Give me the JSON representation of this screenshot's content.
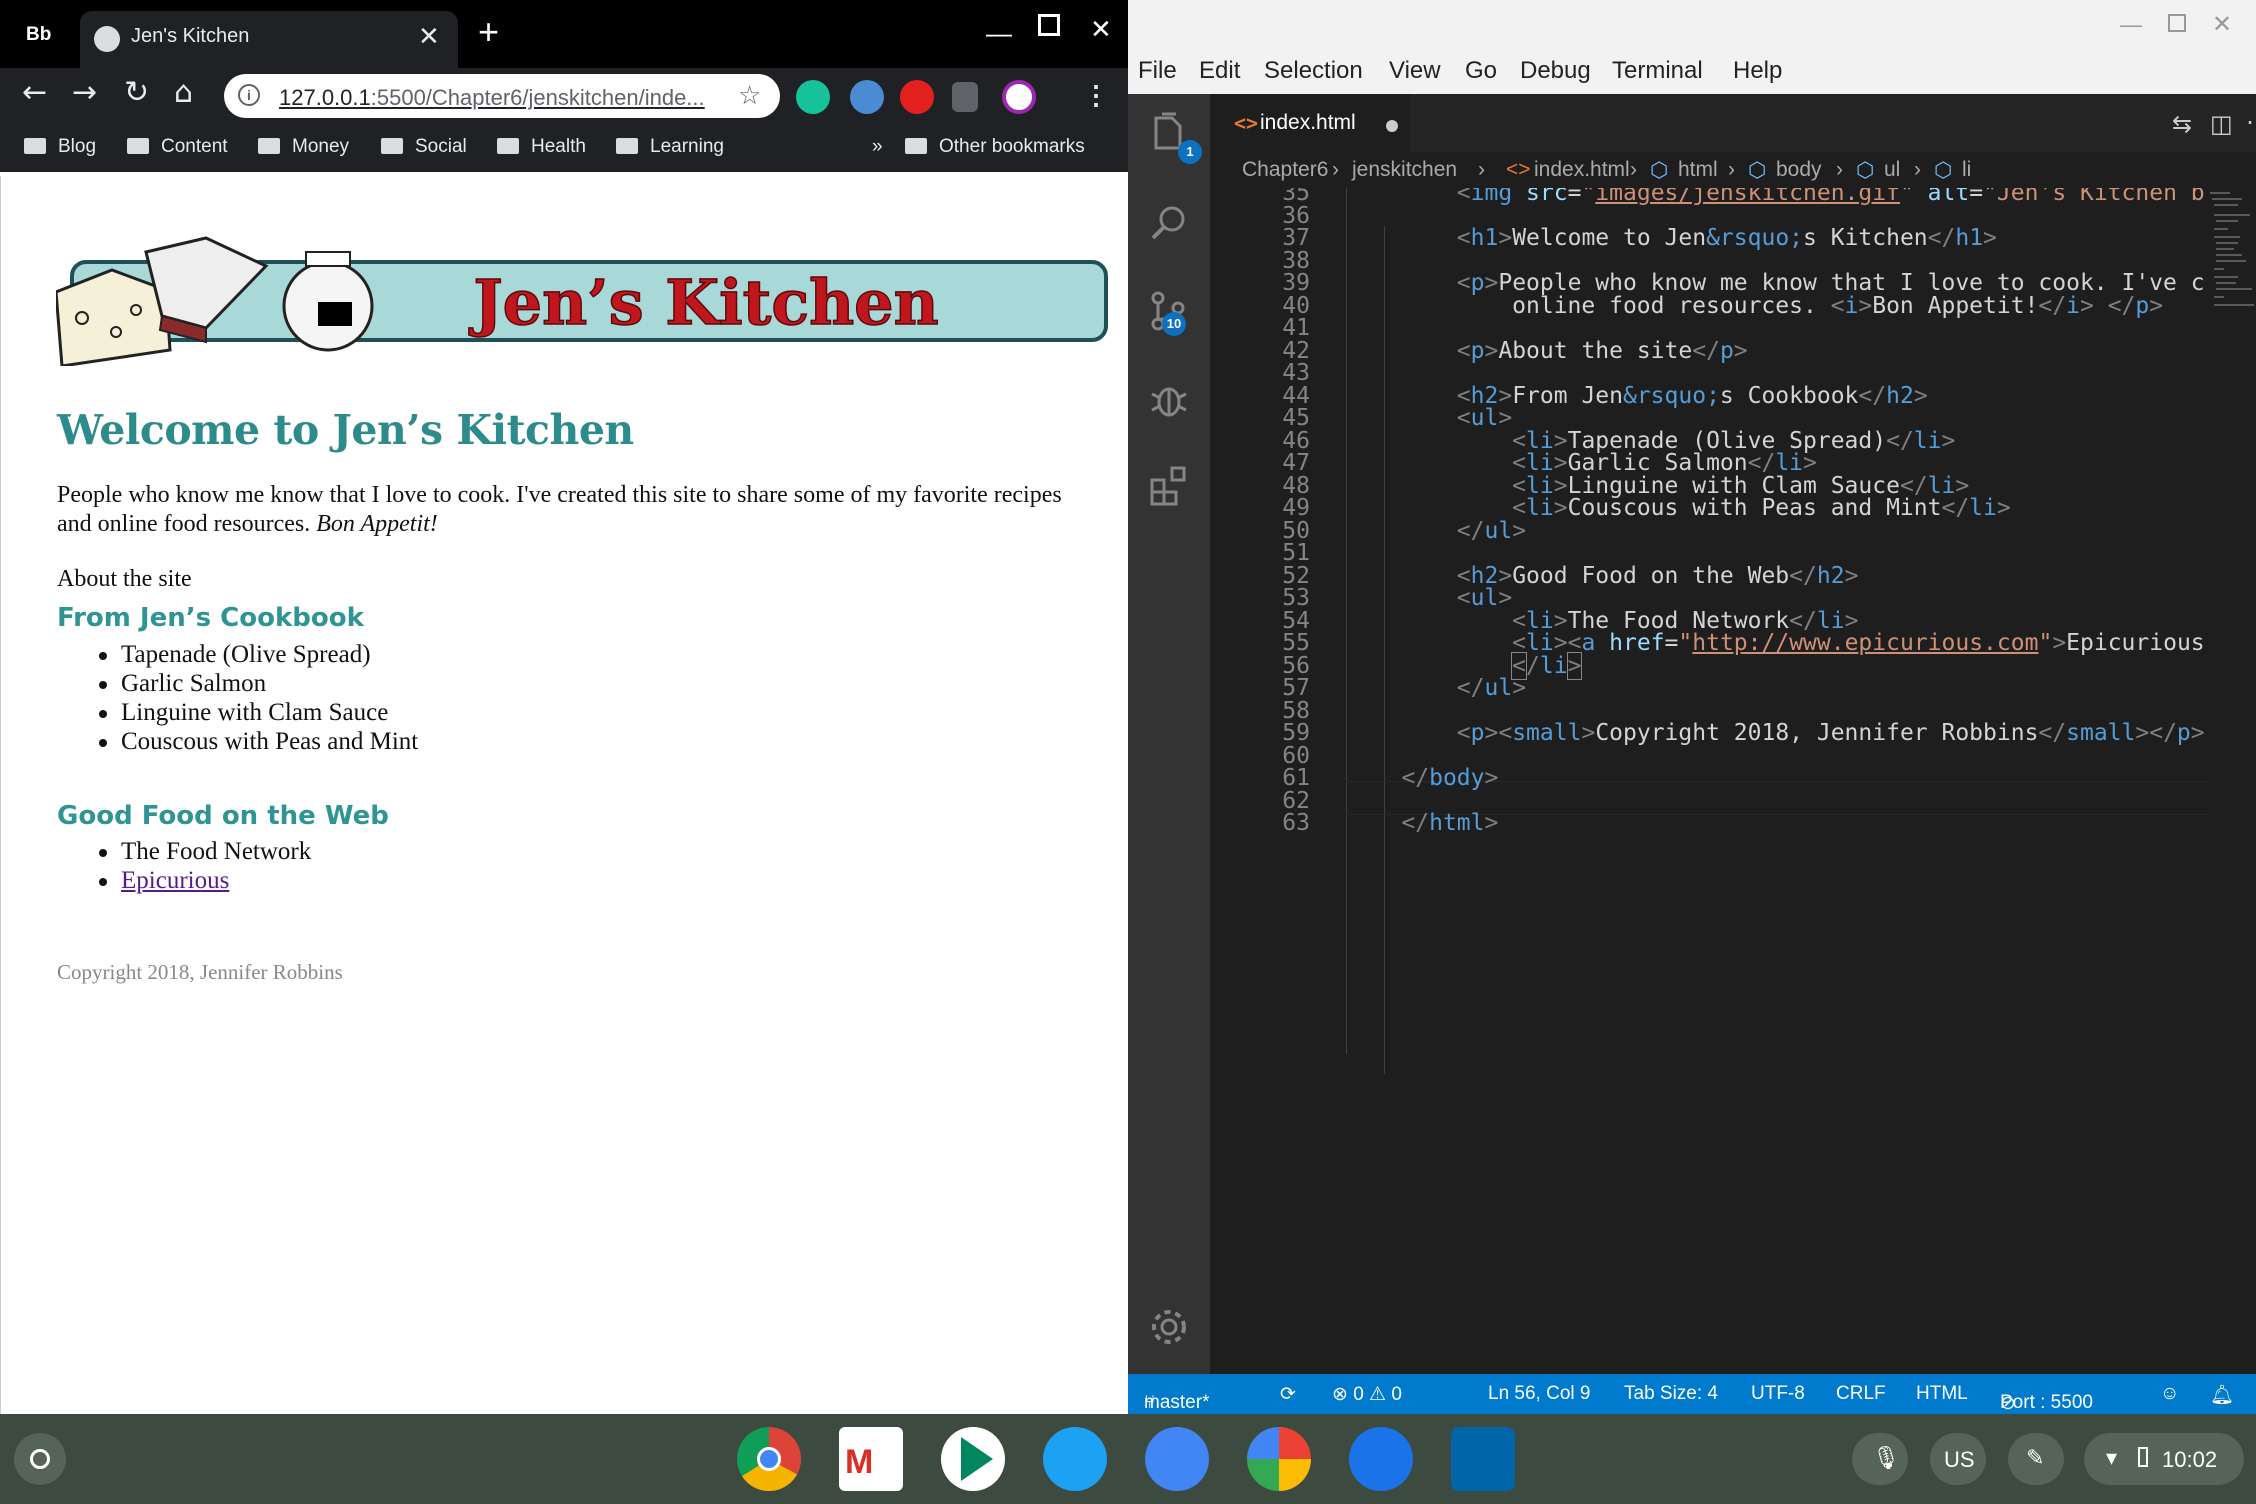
{
  "chrome": {
    "profile_label": "Bb",
    "tab_title": "Jen's Kitchen",
    "url_host": "127.0.0.1",
    "url_rest": ":5500/Chapter6/jenskitchen/inde...",
    "bookmarks": [
      "Blog",
      "Content",
      "Money",
      "Social",
      "Health",
      "Learning"
    ],
    "bookmarks_overflow": "»",
    "other_bookmarks": "Other bookmarks",
    "page": {
      "banner_text": "Jen’s Kitchen",
      "h1": "Welcome to Jen’s Kitchen",
      "intro_text": "People who know me know that I love to cook. I've created this site to share some of my favorite recipes and online food resources. ",
      "intro_em": "Bon Appetit!",
      "about": "About the site",
      "cookbook_heading": "From Jen’s Cookbook",
      "cookbook_items": [
        "Tapenade (Olive Spread)",
        "Garlic Salmon",
        "Linguine with Clam Sauce",
        "Couscous with Peas and Mint"
      ],
      "web_heading": "Good Food on the Web",
      "web_item_1": "The Food Network",
      "web_link": "Epicurious",
      "copyright": "Copyright 2018, Jennifer Robbins"
    }
  },
  "vscode": {
    "menu": [
      "File",
      "Edit",
      "Selection",
      "View",
      "Go",
      "Debug",
      "Terminal",
      "Help"
    ],
    "tab_name": "index.html",
    "breadcrumb": [
      "Chapter6",
      "jenskitchen",
      "index.html",
      "html",
      "body",
      "ul",
      "li"
    ],
    "explorer_badge": "1",
    "scm_badge": "10",
    "line_numbers": [
      "35",
      "36",
      "37",
      "38",
      "39",
      "40",
      "41",
      "42",
      "43",
      "44",
      "45",
      "46",
      "47",
      "48",
      "49",
      "50",
      "51",
      "52",
      "53",
      "54",
      "55",
      "56",
      "57",
      "58",
      "59",
      "60",
      "61",
      "62",
      "63"
    ],
    "status": {
      "branch": "master*",
      "problems": "⊗ 0 ⚠ 0",
      "position": "Ln 56, Col 9",
      "tab_size": "Tab Size: 4",
      "encoding": "UTF-8",
      "eol": "CRLF",
      "language": "HTML",
      "port": "Port : 5500"
    }
  },
  "shelf": {
    "ime": "US",
    "time": "10:02"
  }
}
